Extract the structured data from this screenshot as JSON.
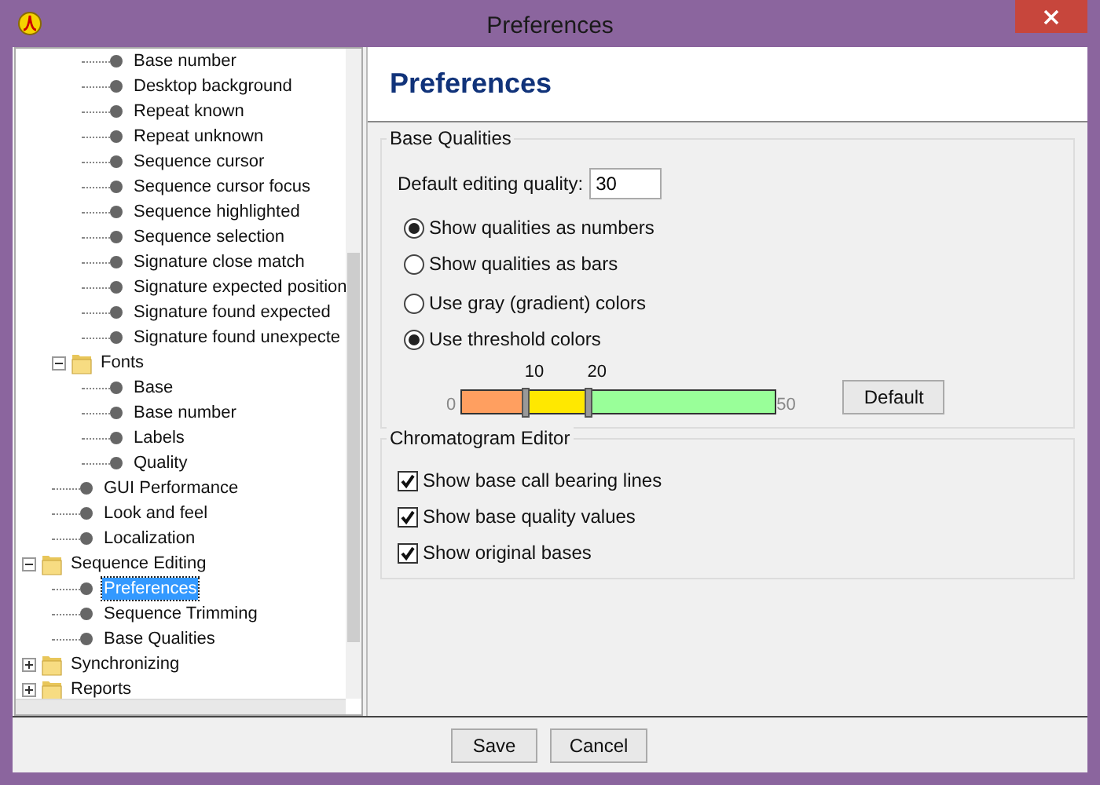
{
  "window": {
    "title": "Preferences"
  },
  "tree": [
    {
      "children": [
        {
          "children": [
            {
              "kind": "leaf",
              "label": "Base number",
              "selected": false
            },
            {
              "kind": "leaf",
              "label": "Desktop background",
              "selected": false
            },
            {
              "kind": "leaf",
              "label": "Repeat known",
              "selected": false
            },
            {
              "kind": "leaf",
              "label": "Repeat unknown",
              "selected": false
            },
            {
              "kind": "leaf",
              "label": "Sequence cursor",
              "selected": false
            },
            {
              "kind": "leaf",
              "label": "Sequence cursor focus",
              "selected": false
            },
            {
              "kind": "leaf",
              "label": "Sequence highlighted",
              "selected": false
            },
            {
              "kind": "leaf",
              "label": "Sequence selection",
              "selected": false
            },
            {
              "kind": "leaf",
              "label": "Signature close match",
              "selected": false
            },
            {
              "kind": "leaf",
              "label": "Signature expected position",
              "selected": false
            },
            {
              "kind": "leaf",
              "label": "Signature found expected",
              "selected": false
            },
            {
              "kind": "leaf",
              "label": "Signature found unexpecte",
              "selected": false
            }
          ]
        },
        {
          "kind": "folder",
          "label": "Fonts",
          "expanded": true,
          "children": [
            {
              "kind": "leaf",
              "label": "Base",
              "selected": false
            },
            {
              "kind": "leaf",
              "label": "Base number",
              "selected": false
            },
            {
              "kind": "leaf",
              "label": "Labels",
              "selected": false
            },
            {
              "kind": "leaf",
              "label": "Quality",
              "selected": false
            }
          ]
        },
        {
          "kind": "leaf",
          "label": "GUI Performance",
          "selected": false
        },
        {
          "kind": "leaf",
          "label": "Look and feel",
          "selected": false
        },
        {
          "kind": "leaf",
          "label": "Localization",
          "selected": false
        }
      ]
    },
    {
      "kind": "folder",
      "label": "Sequence Editing",
      "expanded": true,
      "children": [
        {
          "kind": "leaf",
          "label": "Preferences",
          "selected": true
        },
        {
          "kind": "leaf",
          "label": "Sequence Trimming",
          "selected": false
        },
        {
          "kind": "leaf",
          "label": "Base Qualities",
          "selected": false
        }
      ]
    },
    {
      "kind": "folder",
      "label": "Synchronizing",
      "expanded": false
    },
    {
      "kind": "folder",
      "label": "Reports",
      "expanded": false
    }
  ],
  "panel": {
    "heading": "Preferences",
    "base_qualities": {
      "title": "Base Qualities",
      "quality_label": "Default editing quality:",
      "quality_value": "30",
      "display_mode": [
        {
          "label": "Show qualities as numbers",
          "selected": true
        },
        {
          "label": "Show qualities as bars",
          "selected": false
        }
      ],
      "color_mode": [
        {
          "label": "Use gray (gradient) colors",
          "selected": false
        },
        {
          "label": "Use threshold colors",
          "selected": true
        }
      ],
      "threshold": {
        "min_label": "0",
        "max_label": "50",
        "thumbs": [
          {
            "label": "10",
            "level": 0.2
          },
          {
            "label": "20",
            "level": 0.4
          }
        ],
        "segments": [
          {
            "color": "#ff9f60"
          },
          {
            "color": "#ffe800"
          },
          {
            "color": "#99ff99"
          }
        ]
      },
      "default_button": "Default"
    },
    "chromatogram": {
      "title": "Chromatogram Editor",
      "options": [
        {
          "label": "Show base call bearing lines",
          "checked": true
        },
        {
          "label": "Show base quality values",
          "checked": true
        },
        {
          "label": "Show original bases",
          "checked": true
        }
      ]
    }
  },
  "buttons": [
    "Save",
    "Cancel"
  ]
}
